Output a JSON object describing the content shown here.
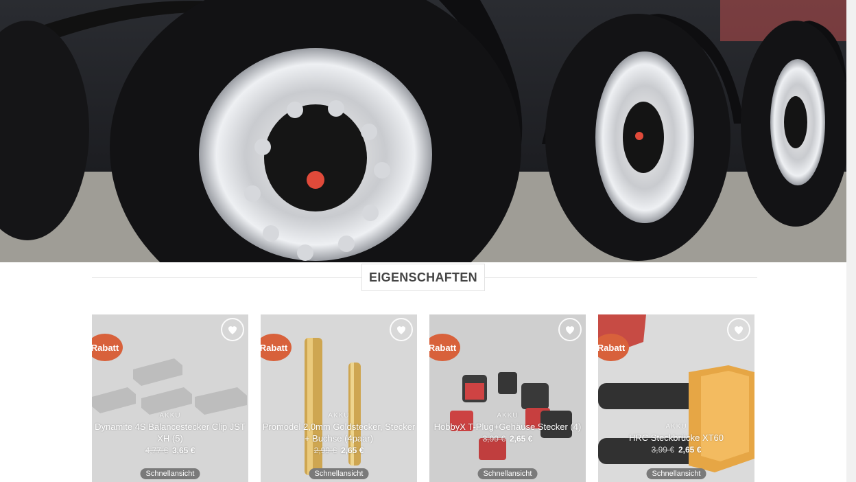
{
  "section": {
    "title": "EIGENSCHAFTEN"
  },
  "products": [
    {
      "badge": "Rabatt",
      "category": "AKKU",
      "name": "Dynamite 4S Balancestecker Clip JST XH (5)",
      "old_price": "4,77 €",
      "new_price": "3,65 €",
      "quick_view": "Schnellansicht",
      "wishlist_icon": "heart-icon",
      "image": "gray-plastic-clips"
    },
    {
      "badge": "Rabatt",
      "category": "AKKU",
      "name": "Promodel 2,0mm Goldstecker, Stecker + Buchse (4paar)",
      "old_price": "2,99 €",
      "new_price": "2,65 €",
      "quick_view": "Schnellansicht",
      "wishlist_icon": "heart-icon",
      "image": "gold-connectors"
    },
    {
      "badge": "Rabatt",
      "category": "AKKU",
      "name": "HobbyX T-Plug+Gehäuse Stecker (4)",
      "old_price": "3,99 €",
      "new_price": "2,65 €",
      "quick_view": "Schnellansicht",
      "wishlist_icon": "heart-icon",
      "image": "red-t-plugs"
    },
    {
      "badge": "Rabatt",
      "category": "AKKU",
      "name": "HRC Steckbrücke XT60",
      "old_price": "3,99 €",
      "new_price": "2,65 €",
      "quick_view": "Schnellansicht",
      "wishlist_icon": "heart-icon",
      "image": "yellow-xt60-bridge"
    }
  ],
  "colors": {
    "badge": "#d8613b",
    "title_text": "#444444",
    "quick_view_bg": "#7a7a7a"
  }
}
